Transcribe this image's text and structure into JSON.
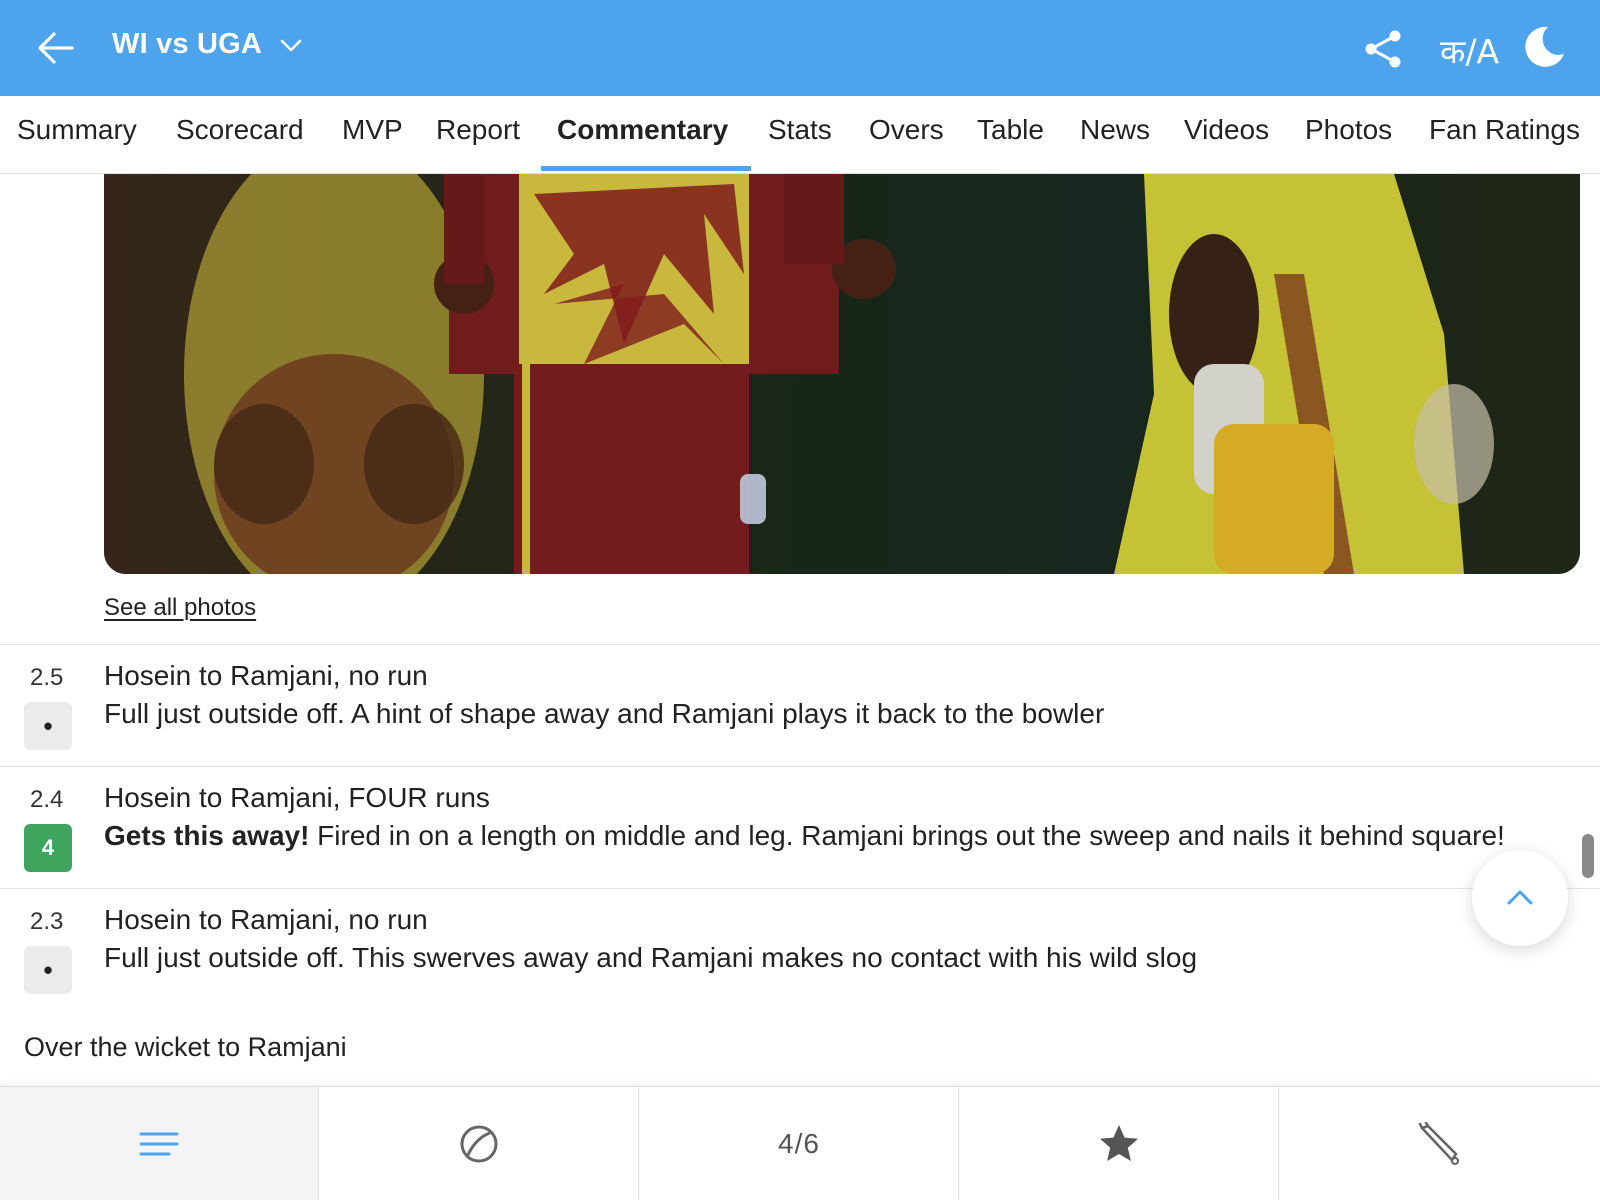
{
  "header": {
    "title": "WI vs UGA",
    "lang_label": "क/A"
  },
  "tabs": [
    {
      "label": "Summary"
    },
    {
      "label": "Scorecard"
    },
    {
      "label": "MVP"
    },
    {
      "label": "Report"
    },
    {
      "label": "Commentary",
      "active": true
    },
    {
      "label": "Stats"
    },
    {
      "label": "Overs"
    },
    {
      "label": "Table"
    },
    {
      "label": "News"
    },
    {
      "label": "Videos"
    },
    {
      "label": "Photos"
    },
    {
      "label": "Fan Ratings"
    }
  ],
  "photo": {
    "see_all_label": "See all photos"
  },
  "commentary": [
    {
      "over": "2.5",
      "result": "•",
      "result_type": "dot",
      "headline": "Hosein to Ramjani, no run",
      "bold_lead": "",
      "text": "Full just outside off. A hint of shape away and Ramjani plays it back to the bowler"
    },
    {
      "over": "2.4",
      "result": "4",
      "result_type": "four",
      "headline": "Hosein to Ramjani, FOUR runs",
      "bold_lead": "Gets this away!",
      "text": " Fired in on a length on middle and leg. Ramjani brings out the sweep and nails it behind square!"
    },
    {
      "over": "2.3",
      "result": "•",
      "result_type": "dot",
      "headline": "Hosein to Ramjani, no run",
      "bold_lead": "",
      "text": "Full just outside off. This swerves away and Ramjani makes no contact with his wild slog"
    }
  ],
  "over_note": "Over the wicket to Ramjani",
  "bottom_nav": {
    "items": [
      {
        "icon": "menu-lines-icon",
        "active": true
      },
      {
        "icon": "ball-icon"
      },
      {
        "icon": "counter",
        "label": "4/6"
      },
      {
        "icon": "star-icon"
      },
      {
        "icon": "bat-icon"
      }
    ]
  },
  "colors": {
    "header_bg": "#4da3ec",
    "accent": "#4da3ec",
    "four_badge": "#3fa55e",
    "dot_badge": "#ebebeb"
  }
}
